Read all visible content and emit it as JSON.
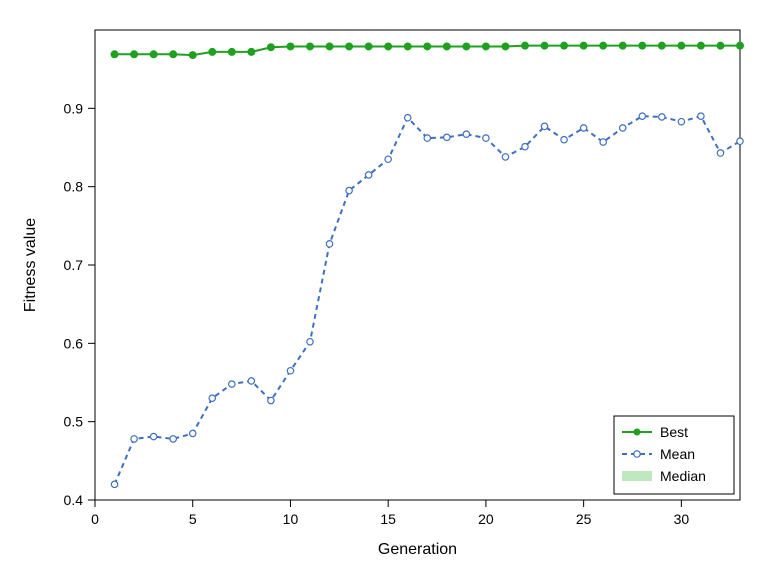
{
  "chart_data": {
    "type": "line",
    "xlabel": "Generation",
    "ylabel": "Fitness value",
    "title": "",
    "xlim": [
      0,
      33
    ],
    "ylim": [
      0.4,
      1.0
    ],
    "x_ticks": [
      0,
      5,
      10,
      15,
      20,
      25,
      30
    ],
    "y_ticks": [
      0.4,
      0.5,
      0.6,
      0.7,
      0.8,
      0.9
    ],
    "x": [
      1,
      2,
      3,
      4,
      5,
      6,
      7,
      8,
      9,
      10,
      11,
      12,
      13,
      14,
      15,
      16,
      17,
      18,
      19,
      20,
      21,
      22,
      23,
      24,
      25,
      26,
      27,
      28,
      29,
      30,
      31,
      32,
      33
    ],
    "series": [
      {
        "name": "Best",
        "color": "#1fa01f",
        "marker": "solid",
        "linestyle": "solid",
        "values": [
          0.969,
          0.969,
          0.969,
          0.969,
          0.968,
          0.972,
          0.972,
          0.972,
          0.978,
          0.979,
          0.979,
          0.979,
          0.979,
          0.979,
          0.979,
          0.979,
          0.979,
          0.979,
          0.979,
          0.979,
          0.979,
          0.98,
          0.98,
          0.98,
          0.98,
          0.98,
          0.98,
          0.98,
          0.98,
          0.98,
          0.98,
          0.98,
          0.98
        ]
      },
      {
        "name": "Mean",
        "color": "#3f6fbf",
        "marker": "open",
        "linestyle": "dashed",
        "values": [
          0.42,
          0.478,
          0.481,
          0.478,
          0.485,
          0.53,
          0.548,
          0.552,
          0.527,
          0.565,
          0.602,
          0.727,
          0.795,
          0.815,
          0.835,
          0.888,
          0.862,
          0.863,
          0.867,
          0.862,
          0.838,
          0.851,
          0.877,
          0.86,
          0.875,
          0.857,
          0.875,
          0.89,
          0.889,
          0.883,
          0.89,
          0.843,
          0.858
        ]
      },
      {
        "name": "Median",
        "color": "#c0e8c0",
        "marker": "band",
        "linestyle": "band",
        "values": []
      }
    ],
    "legend": {
      "position": "bottom-right",
      "entries": [
        "Best",
        "Mean",
        "Median"
      ]
    }
  }
}
